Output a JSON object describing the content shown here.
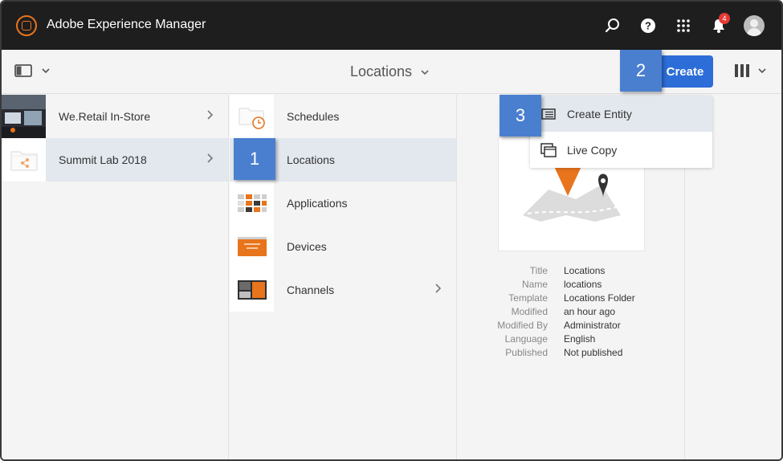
{
  "app": {
    "title": "Adobe Experience Manager",
    "notification_count": "4"
  },
  "actionbar": {
    "breadcrumb_title": "Locations",
    "create_label": "Create"
  },
  "columns": {
    "sites": [
      {
        "label": "We.Retail In-Store",
        "has_children": true
      },
      {
        "label": "Summit Lab 2018",
        "has_children": true,
        "selected": true
      }
    ],
    "folders": [
      {
        "label": "Schedules"
      },
      {
        "label": "Locations",
        "selected": true
      },
      {
        "label": "Applications"
      },
      {
        "label": "Devices"
      },
      {
        "label": "Channels",
        "has_children": true
      }
    ]
  },
  "dropdown": {
    "items": [
      {
        "label": "Create Entity",
        "icon": "entity-icon"
      },
      {
        "label": "Live Copy",
        "icon": "live-copy-icon"
      }
    ]
  },
  "meta": [
    {
      "key": "Title",
      "value": "Locations"
    },
    {
      "key": "Name",
      "value": "locations"
    },
    {
      "key": "Template",
      "value": "Locations Folder"
    },
    {
      "key": "Modified",
      "value": "an hour ago"
    },
    {
      "key": "Modified By",
      "value": "Administrator"
    },
    {
      "key": "Language",
      "value": "English"
    },
    {
      "key": "Published",
      "value": "Not published"
    }
  ],
  "callouts": [
    "1",
    "2",
    "3"
  ],
  "colors": {
    "topbar": "#1e1e1e",
    "brand_orange": "#e8741c",
    "create_blue": "#2c6dd8",
    "callout_blue": "#4a7fcf",
    "selected_row": "#e3e8ef"
  }
}
